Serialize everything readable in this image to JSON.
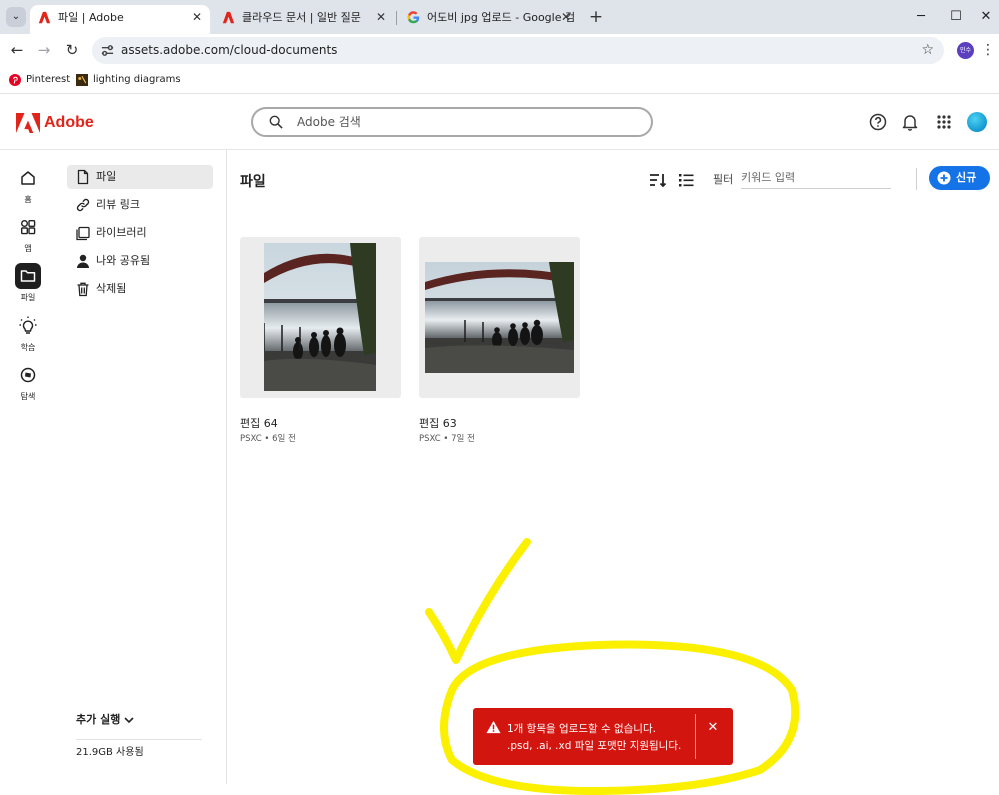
{
  "browser": {
    "tabs": [
      {
        "title": "파일 | Adobe",
        "active": true
      },
      {
        "title": "클라우드 문서 | 일반 질문",
        "active": false
      },
      {
        "title": "어도비 jpg 업로드 - Google 검",
        "active": false
      }
    ],
    "close_glyph": "✕",
    "newtab_glyph": "+",
    "url": "assets.adobe.com/cloud-documents",
    "profile_initials": "민수",
    "bookmarks": [
      {
        "label": "Pinterest"
      },
      {
        "label": "lighting diagrams"
      }
    ]
  },
  "header": {
    "brand": "Adobe",
    "brand_color": "#e1251b",
    "search_placeholder": "Adobe 검색"
  },
  "rail": {
    "items": [
      {
        "label": "홈",
        "icon": "home-icon",
        "active": false
      },
      {
        "label": "앱",
        "icon": "apps-icon",
        "active": false
      },
      {
        "label": "파일",
        "icon": "folder-icon",
        "active": true
      },
      {
        "label": "학습",
        "icon": "lightbulb-icon",
        "active": false
      },
      {
        "label": "탐색",
        "icon": "compass-icon",
        "active": false
      }
    ]
  },
  "subnav": {
    "items": [
      {
        "label": "파일",
        "icon": "file-icon",
        "active": true
      },
      {
        "label": "리뷰 링크",
        "icon": "link-icon",
        "active": false
      },
      {
        "label": "라이브러리",
        "icon": "library-icon",
        "active": false
      },
      {
        "label": "나와 공유됨",
        "icon": "shared-user-icon",
        "active": false
      },
      {
        "label": "삭제됨",
        "icon": "trash-icon",
        "active": false
      }
    ],
    "more_run": "추가 실행",
    "storage_used": "21.9GB 사용됨"
  },
  "main": {
    "title": "파일",
    "filter_label": "필터",
    "filter_placeholder": "키워드 입력",
    "new_button": "신규",
    "accent_color": "#1473e6",
    "files": [
      {
        "name": "편집 64",
        "meta": "PSXC • 6일 전",
        "orientation": "portrait"
      },
      {
        "name": "편집 63",
        "meta": "PSXC • 7일 전",
        "orientation": "landscape"
      }
    ]
  },
  "toast": {
    "line1": "1개 항목을 업로드할 수 없습니다.",
    "line2": ".psd, .ai, .xd 파일 포맷만 지원됩니다.",
    "close_glyph": "✕",
    "color": "#d31510"
  },
  "annotation": {
    "color": "#fbf000",
    "shapes": [
      "check-mark",
      "ellipse"
    ]
  }
}
